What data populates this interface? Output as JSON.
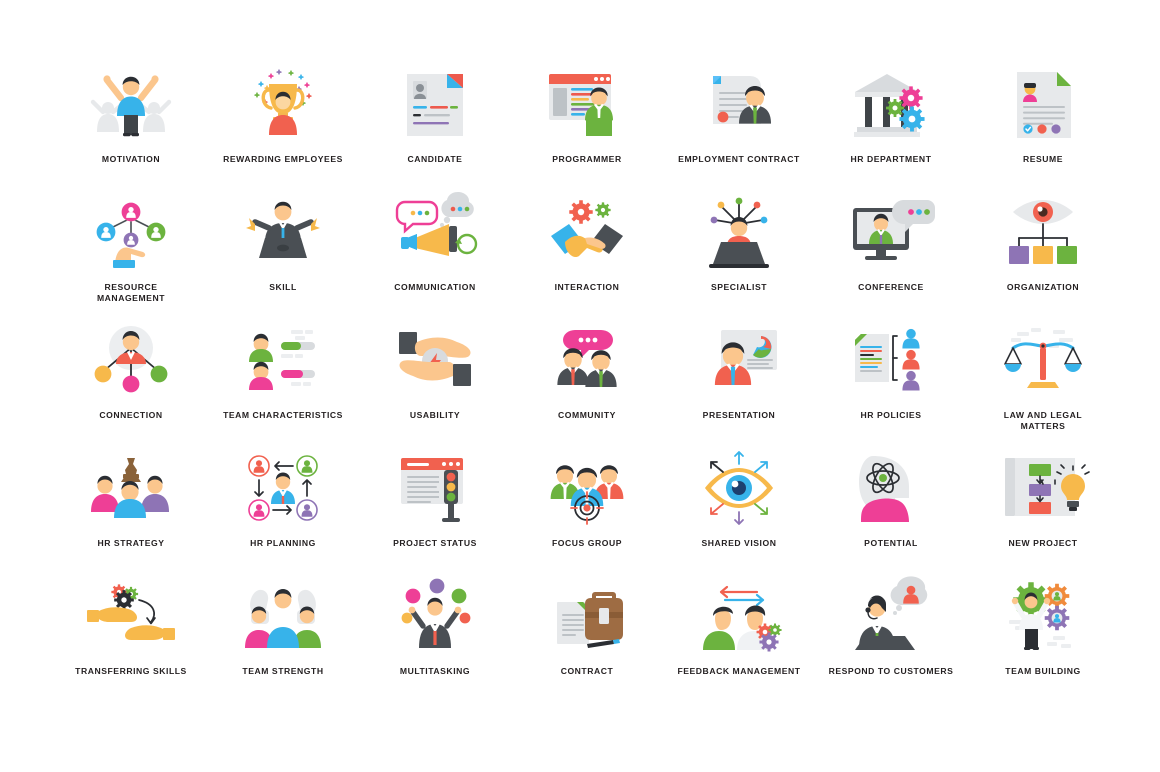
{
  "sheet": {
    "background_color": "#ffffff",
    "columns": 7,
    "rows": 5,
    "label_color": "#231f20"
  },
  "palette": {
    "blue": "#37b3ea",
    "light_blue": "#5bc0f8",
    "deep_blue": "#3b97d3",
    "red": "#ed5a4d",
    "coral": "#f1614f",
    "pink": "#ee3f96",
    "magenta": "#ec4899",
    "green": "#6cb33f",
    "leaf_green": "#77bc43",
    "yellow": "#f7b94b",
    "amber": "#f5b64d",
    "skin": "#fbc68d",
    "skin_light": "#fcd7a1",
    "purple": "#8e74b5",
    "dark": "#3f4448",
    "charcoal": "#4a4f54",
    "hair": "#2b2e33",
    "grey": "#d8dbde",
    "light_grey": "#e7e9eb",
    "mid_grey": "#bdc2c6",
    "white": "#ffffff"
  },
  "icons": [
    {
      "id": "motivation",
      "label": "MOTIVATION",
      "row": 1,
      "col": 1
    },
    {
      "id": "rewarding-employees",
      "label": "REWARDING EMPLOYEES",
      "row": 1,
      "col": 2
    },
    {
      "id": "candidate",
      "label": "CANDIDATE",
      "row": 1,
      "col": 3
    },
    {
      "id": "programmer",
      "label": "PROGRAMMER",
      "row": 1,
      "col": 4
    },
    {
      "id": "employment-contract",
      "label": "EMPLOYMENT CONTRACT",
      "row": 1,
      "col": 5
    },
    {
      "id": "hr-department",
      "label": "HR DEPARTMENT",
      "row": 1,
      "col": 6
    },
    {
      "id": "resume",
      "label": "RESUME",
      "row": 1,
      "col": 7
    },
    {
      "id": "resource-management",
      "label": "RESOURCE\nMANAGEMENT",
      "row": 2,
      "col": 1
    },
    {
      "id": "skill",
      "label": "SKILL",
      "row": 2,
      "col": 2
    },
    {
      "id": "communication",
      "label": "COMMUNICATION",
      "row": 2,
      "col": 3
    },
    {
      "id": "interaction",
      "label": "INTERACTION",
      "row": 2,
      "col": 4
    },
    {
      "id": "specialist",
      "label": "SPECIALIST",
      "row": 2,
      "col": 5
    },
    {
      "id": "conference",
      "label": "CONFERENCE",
      "row": 2,
      "col": 6
    },
    {
      "id": "organization",
      "label": "ORGANIZATION",
      "row": 2,
      "col": 7
    },
    {
      "id": "connection",
      "label": "CONNECTION",
      "row": 3,
      "col": 1
    },
    {
      "id": "team-characteristics",
      "label": "TEAM CHARACTERISTICS",
      "row": 3,
      "col": 2
    },
    {
      "id": "usability",
      "label": "USABILITY",
      "row": 3,
      "col": 3
    },
    {
      "id": "community",
      "label": "COMMUNITY",
      "row": 3,
      "col": 4
    },
    {
      "id": "presentation",
      "label": "PRESENTATION",
      "row": 3,
      "col": 5
    },
    {
      "id": "hr-policies",
      "label": "HR POLICIES",
      "row": 3,
      "col": 6
    },
    {
      "id": "law-and-legal-matters",
      "label": "LAW AND LEGAL\nMATTERS",
      "row": 3,
      "col": 7
    },
    {
      "id": "hr-strategy",
      "label": "HR STRATEGY",
      "row": 4,
      "col": 1
    },
    {
      "id": "hr-planning",
      "label": "HR PLANNING",
      "row": 4,
      "col": 2
    },
    {
      "id": "project-status",
      "label": "PROJECT STATUS",
      "row": 4,
      "col": 3
    },
    {
      "id": "focus-group",
      "label": "FOCUS GROUP",
      "row": 4,
      "col": 4
    },
    {
      "id": "shared-vision",
      "label": "SHARED VISION",
      "row": 4,
      "col": 5
    },
    {
      "id": "potential",
      "label": "POTENTIAL",
      "row": 4,
      "col": 6
    },
    {
      "id": "new-project",
      "label": "NEW PROJECT",
      "row": 4,
      "col": 7
    },
    {
      "id": "transferring-skills",
      "label": "TRANSFERRING SKILLS",
      "row": 5,
      "col": 1
    },
    {
      "id": "team-strength",
      "label": "TEAM STRENGTH",
      "row": 5,
      "col": 2
    },
    {
      "id": "multitasking",
      "label": "MULTITASKING",
      "row": 5,
      "col": 3
    },
    {
      "id": "contract",
      "label": "CONTRACT",
      "row": 5,
      "col": 4
    },
    {
      "id": "feedback-management",
      "label": "FEEDBACK MANAGEMENT",
      "row": 5,
      "col": 5
    },
    {
      "id": "respond-to-customers",
      "label": "RESPOND TO CUSTOMERS",
      "row": 5,
      "col": 6
    },
    {
      "id": "team-building",
      "label": "TEAM BUILDING",
      "row": 5,
      "col": 7
    }
  ]
}
